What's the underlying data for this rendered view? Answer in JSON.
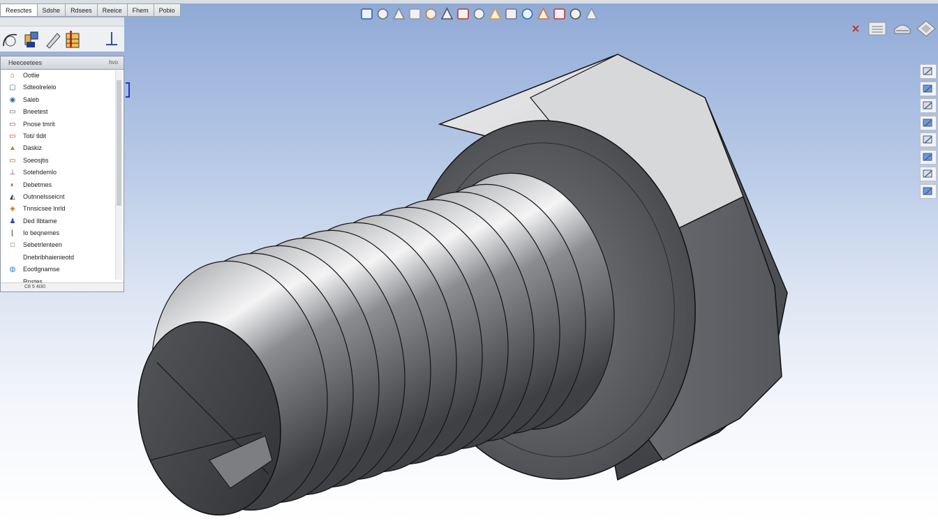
{
  "tabs": [
    {
      "label": "Reesctes"
    },
    {
      "label": "Sdshe"
    },
    {
      "label": "Rdsees"
    },
    {
      "label": "Reeice"
    },
    {
      "label": "Fhem"
    },
    {
      "label": "Pobio"
    }
  ],
  "command_icons": [
    "sketch-icon",
    "features-icon",
    "sketch-pen-icon",
    "evaluate-icon",
    "dimension-icon"
  ],
  "tree": {
    "title": "Heeceetees",
    "pin_label": "hvo",
    "items": [
      {
        "label": "Ootlie",
        "icon": "part-icon",
        "color": "#c0392b"
      },
      {
        "label": "Sdteolrelelo",
        "icon": "sensors-icon",
        "color": "#2e5fb0"
      },
      {
        "label": "Saleb",
        "icon": "annotations-icon",
        "color": "#2e5fb0"
      },
      {
        "label": "Bneetest",
        "icon": "material-icon",
        "color": "#555555"
      },
      {
        "label": "Pnose tmrit",
        "icon": "plane-icon",
        "color": "#b03040"
      },
      {
        "label": "Toti/ tldit",
        "icon": "plane-icon",
        "color": "#cc2222"
      },
      {
        "label": "Daskiz",
        "icon": "extrude-icon",
        "color": "#d87a1a"
      },
      {
        "label": "Soeosjtis",
        "icon": "plane-icon",
        "color": "#c0392b"
      },
      {
        "label": "Sotehdemlo",
        "icon": "axis-icon",
        "color": "#555555"
      },
      {
        "label": "Debetmes",
        "icon": "fillet-icon",
        "color": "#c0392b"
      },
      {
        "label": "Outnnelsseicnt",
        "icon": "chamfer-icon",
        "color": "#333333"
      },
      {
        "label": "Tnnsicsee lnrld",
        "icon": "thread-icon",
        "color": "#d06a1a"
      },
      {
        "label": "Ded Ilbtame",
        "icon": "user-icon",
        "color": "#2e3fb0"
      },
      {
        "label": "Io beqnemes",
        "icon": "sketch-icon",
        "color": "#333333"
      },
      {
        "label": "Sebetrlenteen",
        "icon": "box-icon",
        "color": "#555555"
      },
      {
        "label": "Dnebribhaienieotd",
        "icon": "",
        "color": "#333333"
      },
      {
        "label": "Eootlgnamse",
        "icon": "cosmetic-icon",
        "color": "#2e7fd0"
      },
      {
        "label": "Rnstes",
        "icon": "",
        "color": "#333333"
      }
    ],
    "footer": "C8  5 4i30"
  },
  "hud_icons": [
    "zoom-icon",
    "zoom-fit-icon",
    "zoom-area-icon",
    "previous-view-icon",
    "section-view-icon",
    "view-orientation-icon",
    "display-style-icon",
    "hide-show-icon",
    "edit-appearance-icon",
    "apply-scene-icon",
    "view-settings-icon",
    "rotate-icon",
    "measure-icon",
    "render-icon",
    "shading-icon"
  ],
  "window_controls": [
    "close-icon",
    "minimize-icon",
    "restore-icon",
    "settings-icon"
  ],
  "taskpane_icons": [
    "resources-icon",
    "design-library-icon",
    "file-explorer-icon",
    "view-palette-icon",
    "appearances-icon",
    "custom-properties-icon",
    "forum-icon",
    "search-icon"
  ],
  "colors": {
    "background_top": "#8fa9d6",
    "background_bottom": "#ffffff",
    "model_gray": "#5b5d61",
    "accent_blue": "#2233cc"
  }
}
